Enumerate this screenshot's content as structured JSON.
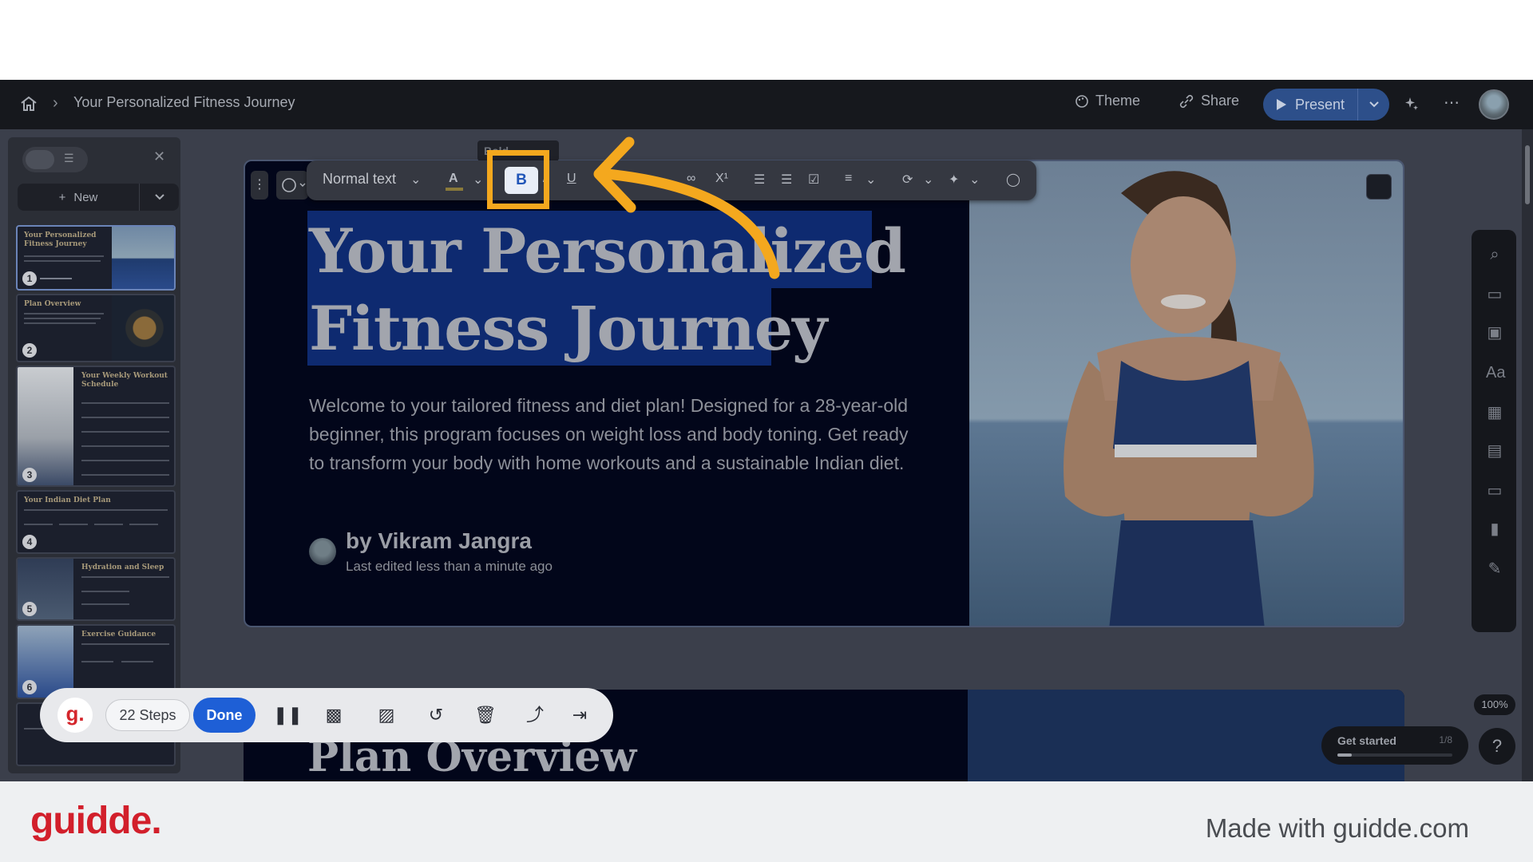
{
  "topbar": {
    "doc_title": "Your Personalized Fitness Journey",
    "theme_label": "Theme",
    "share_label": "Share",
    "present_label": "Present"
  },
  "left_panel": {
    "new_label": "New",
    "thumbnails": [
      {
        "num": "1",
        "title": "Your Personalized Fitness Journey"
      },
      {
        "num": "2",
        "title": "Plan Overview"
      },
      {
        "num": "3",
        "title": "Your Weekly Workout Schedule"
      },
      {
        "num": "4",
        "title": "Your Indian Diet Plan"
      },
      {
        "num": "5",
        "title": "Hydration and Sleep"
      },
      {
        "num": "6",
        "title": "Exercise Guidance"
      }
    ]
  },
  "toolbar": {
    "text_style": "Normal text",
    "tooltip": "Bold",
    "bold_label": "B",
    "underline_label": "U"
  },
  "slide": {
    "title_line1": "Your Personalized",
    "title_line2": "Fitness Journey",
    "body": "Welcome to your tailored fitness and diet plan! Designed for a 28-year-old beginner, this program focuses on weight loss and body toning. Get ready to transform your body with home workouts and a sustainable Indian diet.",
    "author": "by Vikram Jangra",
    "edited": "Last edited less than a minute ago"
  },
  "slide2": {
    "title": "Plan Overview"
  },
  "zoom": "100%",
  "get_started": {
    "label": "Get started",
    "count": "1/8",
    "progress": 0.125
  },
  "recorder": {
    "logo": "g.",
    "steps_label": "22 Steps",
    "done_label": "Done"
  },
  "footer": {
    "brand": "guidde.",
    "made_with": "Made with guidde.com"
  },
  "colors": {
    "highlight": "#f4a81e",
    "brand_red": "#d21f2b",
    "done_blue": "#1e5fd6",
    "selection": "#0e2a70"
  }
}
